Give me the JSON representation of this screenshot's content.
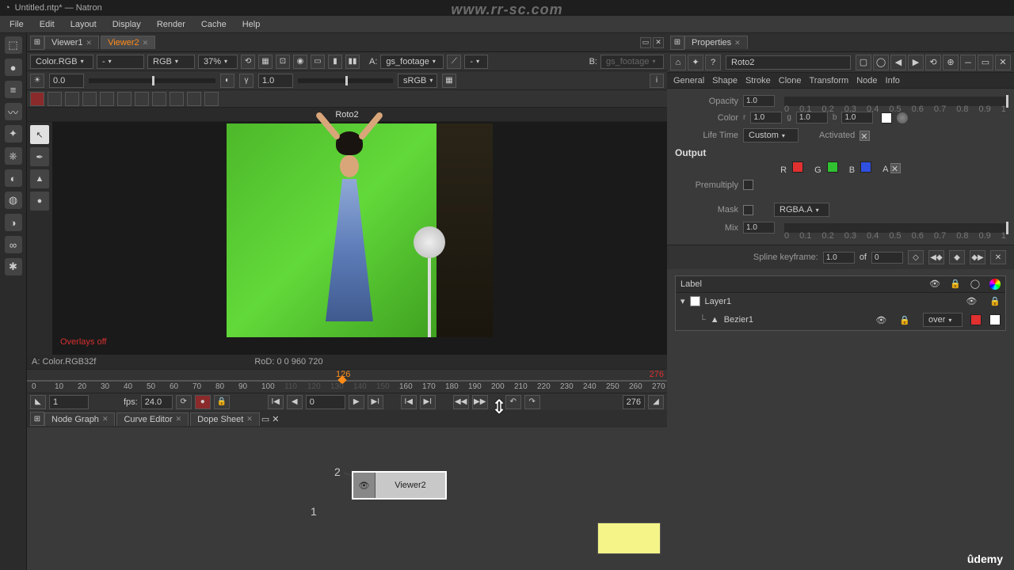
{
  "window": {
    "title": "Untitled.ntp* — Natron"
  },
  "menu": [
    "File",
    "Edit",
    "Layout",
    "Display",
    "Render",
    "Cache",
    "Help"
  ],
  "viewer": {
    "tabs": [
      "Viewer1",
      "Viewer2"
    ],
    "active_tab": "Viewer2",
    "layer": "Color.RGB",
    "alpha_dash": "-",
    "channels": "RGB",
    "zoom": "37%",
    "a_label": "A:",
    "a_input": "gs_footage",
    "a_op": "-",
    "b_label": "B:",
    "b_input": "gs_footage",
    "gamma": "1.0",
    "gain": "0.0",
    "colorspace": "sRGB",
    "roto_title": "Roto2",
    "overlays": "Overlays off",
    "info_a": "A: Color.RGB32f",
    "info_rod": "RoD: 0 0 960 720"
  },
  "timeline": {
    "current": "126",
    "end_float": "276",
    "ticks": [
      "0",
      "10",
      "20",
      "30",
      "40",
      "50",
      "60",
      "70",
      "80",
      "90",
      "100",
      "110",
      "120",
      "130",
      "140",
      "150",
      "160",
      "170",
      "180",
      "190",
      "200",
      "210",
      "220",
      "230",
      "240",
      "250",
      "260",
      "270"
    ],
    "end": "276",
    "start_in": "1",
    "fps_label": "fps:",
    "fps": "24.0",
    "curframe": "0"
  },
  "nodegraph": {
    "tabs": [
      "Node Graph",
      "Curve Editor",
      "Dope Sheet"
    ],
    "viewer_node": "Viewer2",
    "port1": "1",
    "port2": "2"
  },
  "properties": {
    "title": "Properties",
    "node": "Roto2",
    "tabs": [
      "General",
      "Shape",
      "Stroke",
      "Clone",
      "Transform",
      "Node",
      "Info"
    ],
    "opacity_label": "Opacity",
    "opacity": "1.0",
    "color_label": "Color",
    "color_r": "1.0",
    "color_g": "1.0",
    "color_b": "1.0",
    "color_gl": "g",
    "color_bl": "b",
    "color_rl": "r",
    "lifetime_label": "Life Time",
    "lifetime": "Custom",
    "activated_label": "Activated",
    "output_head": "Output",
    "rgba": {
      "r": "R",
      "g": "G",
      "b": "B",
      "a": "A"
    },
    "premult_label": "Premultiply",
    "mask_label": "Mask",
    "mask_channel": "RGBA.A",
    "mix_label": "Mix",
    "mix": "1.0",
    "mix_ticks": [
      "0",
      "0.1",
      "0.2",
      "0.3",
      "0.4",
      "0.5",
      "0.6",
      "0.7",
      "0.8",
      "0.9",
      "1"
    ],
    "op_ticks": [
      "0",
      "0.1",
      "0.2",
      "0.3",
      "0.4",
      "0.5",
      "0.6",
      "0.7",
      "0.8",
      "0.9",
      "1"
    ],
    "spline_label": "Spline keyframe:",
    "spline_val": "1.0",
    "spline_of": "of",
    "spline_total": "0",
    "layers_header": "Label",
    "layer1": "Layer1",
    "bezier1": "Bezier1",
    "blend": "over"
  },
  "watermark_top": "www.rr-sc.com",
  "udemy": "ûdemy"
}
